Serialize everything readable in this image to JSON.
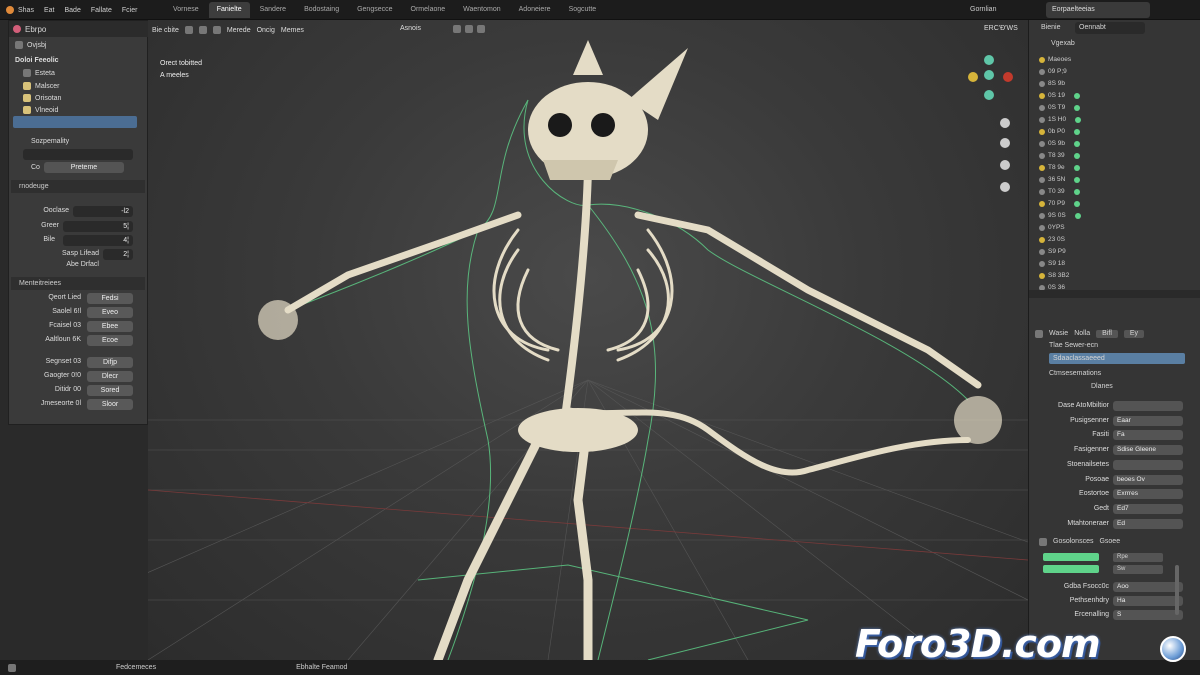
{
  "topbar": {
    "menu": [
      "Shas",
      "Eat",
      "Bade",
      "Fallate",
      "Fcier"
    ],
    "workspace_tabs": [
      "Vornese",
      "Fanielte",
      "Sandere",
      "Bodostaing",
      "Gengsecce",
      "Ormelaone",
      "Waentomon",
      "Adoneiere",
      "Sogcutte"
    ],
    "active_tab_index": 1,
    "scene_label": "Gornlian",
    "view_label": "Eorpaelteeias"
  },
  "left_panel": {
    "header": "Ebrpo",
    "sub_header": "Ovjsbj",
    "tree_title": "Doloi Feeolic",
    "tree_items": [
      "Esteta",
      "Malscer",
      "Orisotan",
      "Vlneoid"
    ],
    "symmetry_label": "Sozpemality",
    "preset_key": "Co",
    "preset_value": "Preteme",
    "section_mode": "rnodeuge",
    "props": [
      {
        "label": "Ooclase",
        "value": "-l2"
      },
      {
        "label": "Greer",
        "value": "5¦"
      },
      {
        "label": "Bile",
        "value": "4¦"
      },
      {
        "label": "Sasp Lifead",
        "value": "2¦"
      }
    ],
    "props_note": "Abe Drfacl",
    "section_buttons": "Menteitreiees",
    "button_rows": [
      {
        "label": "Qeort Lied",
        "button": "Fedsi"
      },
      {
        "label": "Saolel 6!l",
        "button": "Eveo"
      },
      {
        "label": "Fcaisel 03",
        "button": "Ebee"
      },
      {
        "label": "Aaltloun 6K",
        "button": "Ecoe"
      },
      {
        "label": "Segnset 03",
        "button": "Difjp"
      },
      {
        "label": "Gaogter 0!0",
        "button": "Dlecr"
      },
      {
        "label": "Ditidr 00",
        "button": "Sored"
      },
      {
        "label": "Jmeseorte 0l",
        "button": "Sloor"
      }
    ]
  },
  "viewport": {
    "toolbar": [
      "Bie cbite",
      "Merede",
      "Oncig",
      "Memes"
    ],
    "mode_label": "Asnois",
    "overlay_title": "Orect tobitted",
    "overlay_sub": "A meeles",
    "render_label": "ERC'Ð'WS"
  },
  "right_panel": {
    "header": "Bienie",
    "tab": "Oennabt",
    "outliner_title": "Vgexab",
    "outliner_rows": [
      "Maeoes",
      "09 P;9",
      "8S 9b",
      "0S 19",
      "0S T9",
      "1S H0",
      "0b P0",
      "0S 9b",
      "T8 39",
      "T8 9e",
      "36 5N",
      "T0 39",
      "70 P9",
      "9S 0S",
      "0YPS",
      "23 0S",
      "S9 P9",
      "S9 18",
      "S8 3B2",
      "0S 36"
    ],
    "prop_tabs": [
      "Wasie",
      "Nolla",
      "Bifl",
      "Ey"
    ],
    "prop_section": "Tlae Sewer-ecn",
    "dropdown_value": "Sdaaclassaeeed",
    "sub_section": "Ctmsesemations",
    "sub_title": "Dlanes",
    "props": [
      {
        "label": "Dase AtoMbiltior",
        "value": ""
      },
      {
        "label": "Pusigsenner",
        "value": "Eaar"
      },
      {
        "label": "Fasiti",
        "value": "Fa"
      },
      {
        "label": "Fasigenner",
        "value": "Sdise Gleene"
      },
      {
        "label": "Stoenailsetes",
        "value": ""
      },
      {
        "label": "Posoae",
        "value": "beoes Ov"
      },
      {
        "label": "Eostortoe",
        "value": "Exrrres"
      },
      {
        "label": "Gedt",
        "value": "Ed7"
      },
      {
        "label": "Mtahtoneraer",
        "value": "Ed"
      }
    ],
    "section2": "Gosolonsces",
    "section2_value": "Gsoee",
    "props2": [
      {
        "label": "Gdba Fsocc0c",
        "value": "Aoo"
      },
      {
        "label": "Pethsenhdry",
        "value": "Ha"
      },
      {
        "label": "Ercenalling",
        "value": "S"
      }
    ],
    "bar_values": [
      "Rpe",
      "Sw"
    ]
  },
  "statusbar": {
    "left": "Fedcemeces",
    "right": "Ebhalte Feamod"
  },
  "watermark": "Foro3D.com",
  "colors": {
    "accent_green": "#5fd38a",
    "accent_blue": "#5a7fa3",
    "bone": "#e4dcc6"
  }
}
